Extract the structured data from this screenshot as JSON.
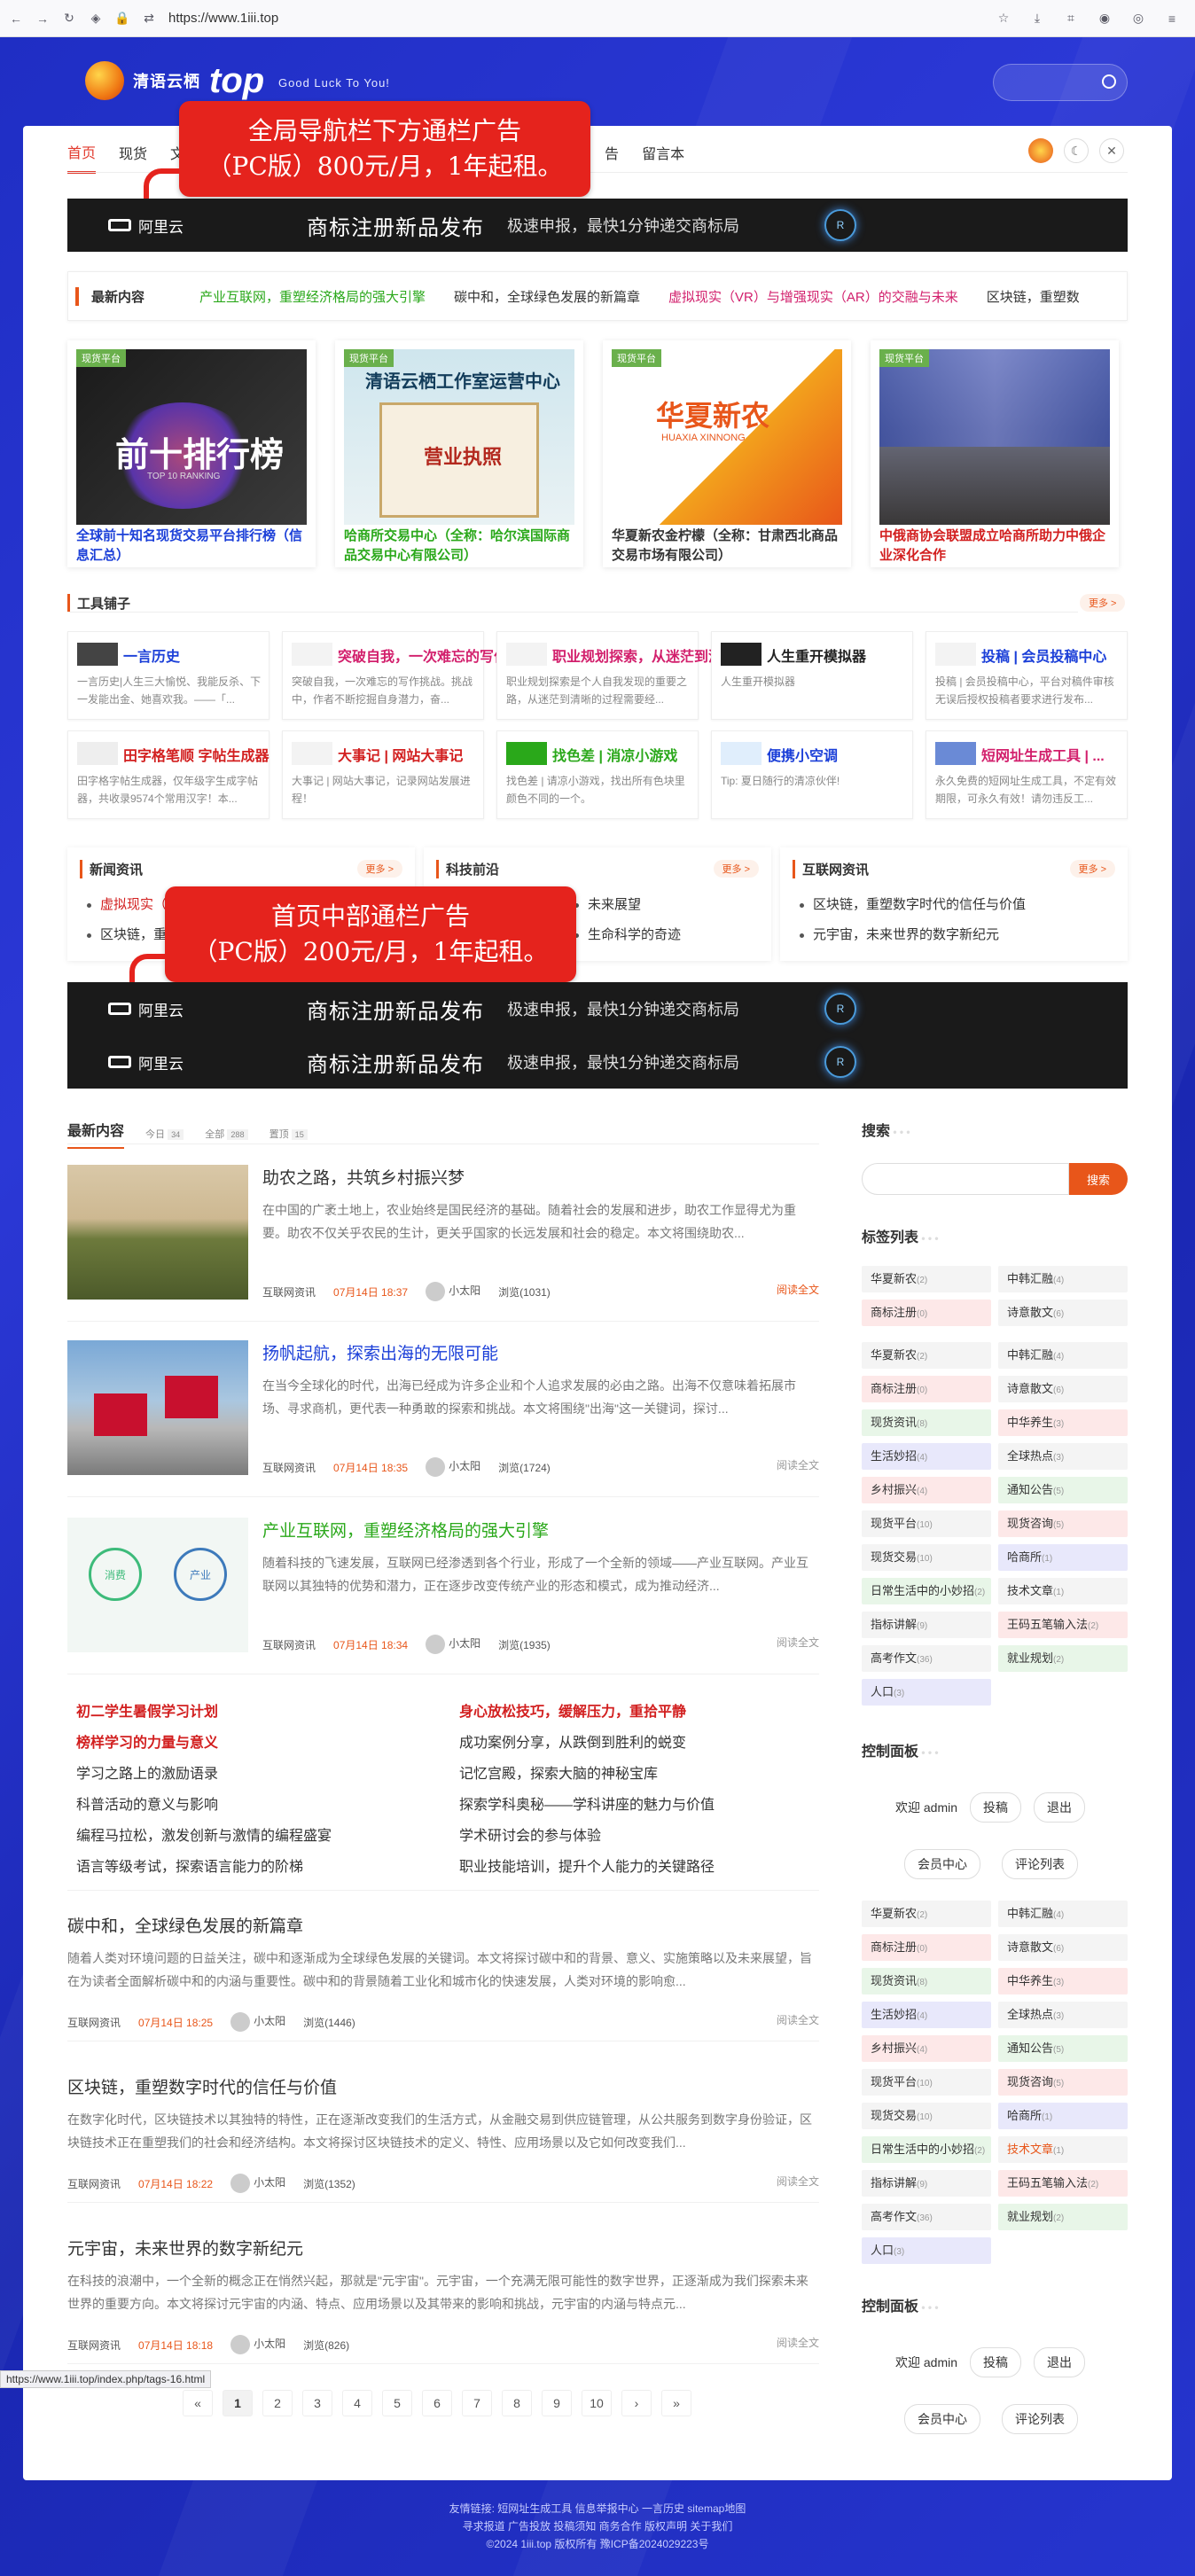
{
  "browser": {
    "url": "https://www.1iii.top"
  },
  "header": {
    "site_name": "清语云栖",
    "logo_word": "top",
    "slogan": "Good Luck To You!"
  },
  "nav": {
    "items": [
      "首页",
      "现货",
      "文",
      "告",
      "留言本"
    ]
  },
  "promo_top": {
    "line1": "全局导航栏下方通栏广告",
    "line2": "（PC版）800元/月，1年起租。"
  },
  "promo_mid": {
    "line1": "首页中部通栏广告",
    "line2": "（PC版）200元/月，1年起租。"
  },
  "ad": {
    "brand": "阿里云",
    "headline": "商标注册新品发布",
    "sub": "极速申报，最快1分钟递交商标局",
    "orb": "R"
  },
  "ticker": {
    "label": "最新内容",
    "items": [
      "产业互联网，重塑经济格局的强大引擎",
      "碳中和，全球绿色发展的新篇章",
      "虚拟现实（VR）与增强现实（AR）的交融与未来",
      "区块链，重塑数"
    ]
  },
  "features": [
    {
      "tag": "现货平台",
      "img_text": "前十排行榜",
      "img_sub": "TOP 10 RANKING",
      "caption": "全球前十知名现货交易平台排行榜（信息汇总）",
      "color": "#1b3fd8"
    },
    {
      "tag": "现货平台",
      "img_text": "清语云栖工作室运营中心",
      "img_sub": "营业执照",
      "caption": "哈商所交易中心（全称：哈尔滨国际商品交易中心有限公司）",
      "color": "#2aa81a"
    },
    {
      "tag": "现货平台",
      "img_text": "华夏新农",
      "img_sub": "HUAXIA XINNONG",
      "caption": "华夏新农金柠檬（全称：甘肃西北商品交易市场有限公司）",
      "color": "#333333"
    },
    {
      "tag": "现货平台",
      "img_text": "",
      "img_sub": "",
      "caption": "中俄商协会联盟成立哈商所助力中俄企业深化合作",
      "color": "#d21f1f"
    }
  ],
  "tools": {
    "title": "工具铺子",
    "more": "更多 >",
    "items": [
      {
        "title": "一言历史",
        "desc": "一言历史|人生三大愉悦、我能反杀、下一发能出金、她喜欢我。——「...",
        "color": "#1b3fd8"
      },
      {
        "title": "突破自我，一次难忘的写作...",
        "desc": "突破自我，一次难忘的写作挑战。挑战中，作者不断挖掘自身潜力，奋...",
        "color": "#d21f6c"
      },
      {
        "title": "职业规划探索，从迷茫到清...",
        "desc": "职业规划探索是个人自我发现的重要之路，从迷茫到清晰的过程需要经...",
        "color": "#d21f6c"
      },
      {
        "title": "人生重开模拟器",
        "desc": "人生重开模拟器",
        "color": "#222222"
      },
      {
        "title": "投稿 | 会员投稿中心",
        "desc": "投稿 | 会员投稿中心，平台对稿件审核无误后授权投稿者要求进行发布...",
        "color": "#1b3fd8"
      },
      {
        "title": "田字格笔顺 字帖生成器",
        "desc": "田字格字帖生成器，仅年级字生成字帖器，共收录9574个常用汉字！本...",
        "color": "#d21f1f"
      },
      {
        "title": "大事记 | 网站大事记",
        "desc": "大事记 | 网站大事记，记录网站发展进程！",
        "color": "#d21f1f"
      },
      {
        "title": "找色差 | 消凉小游戏",
        "desc": "找色差 | 请凉小游戏，找出所有色块里颜色不同的一个。",
        "color": "#2aa81a"
      },
      {
        "title": "便携小空调",
        "desc": "Tip: 夏日随行的清凉伙伴!",
        "color": "#1b3fd8"
      },
      {
        "title": "短网址生成工具 | ...",
        "desc": "永久免费的短网址生成工具，不定有效期限，可永久有效！请勿违反工...",
        "color": "#d21f6c"
      }
    ]
  },
  "newsboxes": [
    {
      "title": "新闻资讯",
      "more": "更多 >",
      "items": [
        "虚拟现实（VR）",
        "区块链，重塑"
      ]
    },
    {
      "title": "科技前沿",
      "more": "更多 >",
      "items": [
        "未来展望",
        "生命科学的奇迹"
      ]
    },
    {
      "title": "互联网资讯",
      "more": "更多 >",
      "items": [
        "区块链，重塑数字时代的信任与价值",
        "元宇宙，未来世界的数字新纪元"
      ]
    }
  ],
  "latest": {
    "tab_title": "最新内容",
    "stats": [
      {
        "label": "今日",
        "value": "34"
      },
      {
        "label": "全部",
        "value": "288"
      },
      {
        "label": "置顶",
        "value": "15"
      }
    ]
  },
  "articles": [
    {
      "title": "助农之路，共筑乡村振兴梦",
      "excerpt": "在中国的广袤土地上，农业始终是国民经济的基础。随着社会的发展和进步，助农工作显得尤为重要。助农不仅关乎农民的生计，更关乎国家的长远发展和社会的稳定。本文将围绕助农...",
      "category": "互联网资讯",
      "date": "07月14日 18:37",
      "author": "小太阳",
      "views": "浏览(1031)",
      "more": "阅读全文",
      "title_color": "#333333"
    },
    {
      "title": "扬帆起航，探索出海的无限可能",
      "excerpt": "在当今全球化的时代，出海已经成为许多企业和个人追求发展的必由之路。出海不仅意味着拓展市场、寻求商机，更代表一种勇敢的探索和挑战。本文将围绕\"出海\"这一关键词，探讨...",
      "category": "互联网资讯",
      "date": "07月14日 18:35",
      "author": "小太阳",
      "views": "浏览(1724)",
      "more": "阅读全文",
      "title_color": "#1b3fd8"
    },
    {
      "title": "产业互联网，重塑经济格局的强大引擎",
      "excerpt": "随着科技的飞速发展，互联网已经渗透到各个行业，形成了一个全新的领域——产业互联网。产业互联网以其独特的优势和潜力，正在逐步改变传统产业的形态和模式，成为推动经济...",
      "category": "互联网资讯",
      "date": "07月14日 18:34",
      "author": "小太阳",
      "views": "浏览(1935)",
      "more": "阅读全文",
      "title_color": "#2aa81a"
    }
  ],
  "linklist": {
    "left": [
      {
        "t": "初二学生暑假学习计划",
        "c": "#d21f1f"
      },
      {
        "t": "榜样学习的力量与意义",
        "c": "#d21f1f"
      },
      {
        "t": "学习之路上的激励语录",
        "c": "#333333"
      },
      {
        "t": "科普活动的意义与影响",
        "c": "#333333"
      },
      {
        "t": "编程马拉松，激发创新与激情的编程盛宴",
        "c": "#333333"
      },
      {
        "t": "语言等级考试，探索语言能力的阶梯",
        "c": "#333333"
      }
    ],
    "right": [
      {
        "t": "身心放松技巧，缓解压力，重拾平静",
        "c": "#d21f1f"
      },
      {
        "t": "成功案例分享，从跌倒到胜利的蜕变",
        "c": "#333333"
      },
      {
        "t": "记忆宫殿，探索大脑的神秘宝库",
        "c": "#333333"
      },
      {
        "t": "探索学科奥秘——学科讲座的魅力与价值",
        "c": "#333333"
      },
      {
        "t": "学术研讨会的参与体验",
        "c": "#333333"
      },
      {
        "t": "职业技能培训，提升个人能力的关键路径",
        "c": "#333333"
      }
    ]
  },
  "textarticles": [
    {
      "title": "碳中和，全球绿色发展的新篇章",
      "excerpt": "随着人类对环境问题的日益关注，碳中和逐渐成为全球绿色发展的关键词。本文将探讨碳中和的背景、意义、实施策略以及未来展望，旨在为读者全面解析碳中和的内涵与重要性。碳中和的背景随着工业化和城市化的快速发展，人类对环境的影响愈...",
      "category": "互联网资讯",
      "date": "07月14日 18:25",
      "author": "小太阳",
      "views": "浏览(1446)",
      "more": "阅读全文"
    },
    {
      "title": "区块链，重塑数字时代的信任与价值",
      "excerpt": "在数字化时代，区块链技术以其独特的特性，正在逐渐改变我们的生活方式，从金融交易到供应链管理，从公共服务到数字身份验证，区块链技术正在重塑我们的社会和经济结构。本文将探讨区块链技术的定义、特性、应用场景以及它如何改变我们...",
      "category": "互联网资讯",
      "date": "07月14日 18:22",
      "author": "小太阳",
      "views": "浏览(1352)",
      "more": "阅读全文"
    },
    {
      "title": "元宇宙，未来世界的数字新纪元",
      "excerpt": "在科技的浪潮中，一个全新的概念正在悄然兴起，那就是\"元宇宙\"。元宇宙，一个充满无限可能性的数字世界，正逐渐成为我们探索未来世界的重要方向。本文将探讨元宇宙的内涵、特点、应用场景以及其带来的影响和挑战，元宇宙的内涵与特点元...",
      "category": "互联网资讯",
      "date": "07月14日 18:18",
      "author": "小太阳",
      "views": "浏览(826)",
      "more": "阅读全文"
    }
  ],
  "pager": [
    "«",
    "1",
    "2",
    "3",
    "4",
    "5",
    "6",
    "7",
    "8",
    "9",
    "10",
    "›",
    "»"
  ],
  "sidebar": {
    "search_title": "搜索",
    "search_button": "搜索",
    "tags_title": "标签列表",
    "tags_a": [
      {
        "n": "华夏新农",
        "c": "(2)",
        "bg": "#f4f4f4"
      },
      {
        "n": "中韩汇融",
        "c": "(4)",
        "bg": "#f4f4f4"
      },
      {
        "n": "商标注册",
        "c": "(0)",
        "bg": "#fde8e8"
      },
      {
        "n": "诗意散文",
        "c": "(6)",
        "bg": "#f4f4f4"
      }
    ],
    "tags_b": [
      {
        "n": "华夏新农",
        "c": "(2)",
        "bg": "#f4f4f4"
      },
      {
        "n": "中韩汇融",
        "c": "(4)",
        "bg": "#f4f4f4"
      },
      {
        "n": "商标注册",
        "c": "(0)",
        "bg": "#fde8e8"
      },
      {
        "n": "诗意散文",
        "c": "(6)",
        "bg": "#f4f4f4"
      },
      {
        "n": "现货资讯",
        "c": "(8)",
        "bg": "#e8f6e8"
      },
      {
        "n": "中华养生",
        "c": "(3)",
        "bg": "#fde8e8"
      },
      {
        "n": "生活妙招",
        "c": "(4)",
        "bg": "#e8e8fb"
      },
      {
        "n": "全球热点",
        "c": "(3)",
        "bg": "#f4f4f4"
      },
      {
        "n": "乡村振兴",
        "c": "(4)",
        "bg": "#fde8e8"
      },
      {
        "n": "通知公告",
        "c": "(5)",
        "bg": "#e8f6e8"
      },
      {
        "n": "现货平台",
        "c": "(10)",
        "bg": "#f4f4f4"
      },
      {
        "n": "现货咨询",
        "c": "(5)",
        "bg": "#fde8e8"
      },
      {
        "n": "现货交易",
        "c": "(10)",
        "bg": "#f4f4f4"
      },
      {
        "n": "哈商所",
        "c": "(1)",
        "bg": "#e8e8fb"
      },
      {
        "n": "日常生活中的小妙招",
        "c": "(2)",
        "bg": "#e8f6e8"
      },
      {
        "n": "技术文章",
        "c": "(1)",
        "bg": "#f4f4f4"
      },
      {
        "n": "指标讲解",
        "c": "(9)",
        "bg": "#f4f4f4"
      },
      {
        "n": "王码五笔输入法",
        "c": "(2)",
        "bg": "#fde8e8"
      },
      {
        "n": "高考作文",
        "c": "(36)",
        "bg": "#f4f4f4"
      },
      {
        "n": "就业规划",
        "c": "(2)",
        "bg": "#e8f6e8"
      },
      {
        "n": "人口",
        "c": "(3)",
        "bg": "#e8e8fb"
      }
    ],
    "panel_title": "控制面板",
    "welcome": "欢迎 admin",
    "btn_post": "投稿",
    "btn_logout": "退出",
    "btn_member": "会员中心",
    "btn_comments": "评论列表"
  },
  "status_url": "https://www.1iii.top/index.php/tags-16.html",
  "footer": {
    "line1": "友情链接:  短网址生成工具  信息举报中心  一言历史  sitemap地图",
    "line2": "寻求报道 广告投放 投稿须知 商务合作 版权声明 关于我们",
    "line3": "©2024 1iii.top 版权所有 豫ICP备2024029223号"
  }
}
